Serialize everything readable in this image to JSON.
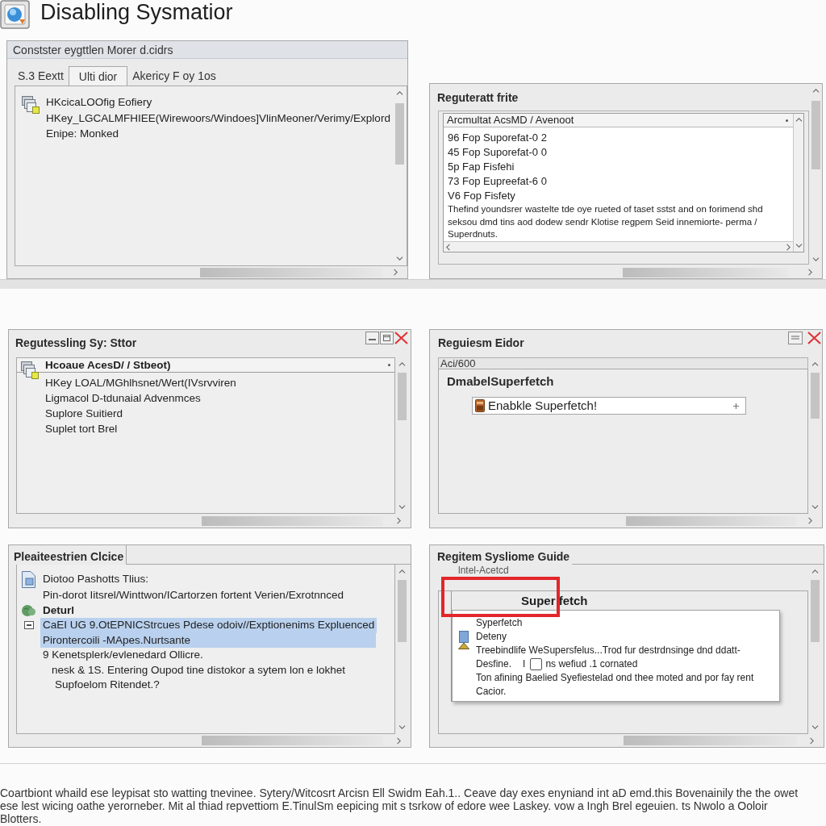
{
  "header": {
    "title": "Disabling Sysmatior"
  },
  "panels": [
    {
      "kind": "tabbed",
      "title": "Constster eygttlen Morer d.cidrs",
      "tabs": [
        {
          "label": "S.3 Eextt",
          "selected": false
        },
        {
          "label": "Ulti dior",
          "selected": true
        },
        {
          "label": "Akericy F oy 1os",
          "selected": false
        }
      ],
      "lines": [
        "HKcicaLOOfig Eofiery",
        "HKey_LGCALMFHIEE(Wirewoors/Windoes]VlinMeoner/Verimy/Explord",
        "Enipe: Monked"
      ]
    },
    {
      "kind": "list",
      "title": "Reguteratt frite",
      "list_header": "Arcmultat AcsMD / Avenoot",
      "rows": [
        "96 Fop Suporefat-0 2",
        "45 Fop Suporefat-0 0",
        "5p Fap Fisfehi",
        "73 Fop Eupreefat-6 0",
        "V6 Fop Fisfety"
      ],
      "note": "Thefind youndsrer wastelte tde oye rueted of taset sstst and on forimend shd seksou dmd tins aod dodew sendr Klotise regpem Seid innemiorte- perma / Superdnuts."
    },
    {
      "kind": "tree_window",
      "title": "Regutessling Sy: Sttor",
      "header": "Hcoaue AcesD/ / Stbeot)",
      "lines": [
        "HKey LOAL/MGhlhsnet/Wert(IVsrvviren",
        "Ligmacol D-tdunaial Advenmces",
        "Suplore Suitierd",
        "Suplet tort Brel"
      ]
    },
    {
      "kind": "editor",
      "title": "Reguiesm Eidor",
      "label": "Aci/600",
      "heading": "DmabelSuperfetch",
      "field": {
        "value": "Enabkle Superfetch!"
      }
    },
    {
      "kind": "outline",
      "title": "Pleaiteestrien Clcice",
      "items": [
        {
          "kind": "document",
          "text": "Diotoo Pashotts Tlius:",
          "selected": false
        },
        {
          "kind": "plain",
          "text": "Pin-dorot Iitsrel/Winttwon/ICartorzen fortent Verien/Exrotnnced",
          "selected": false
        },
        {
          "kind": "heading",
          "text": "Deturl",
          "selected": false
        },
        {
          "kind": "group",
          "text": "CaEI UG 9.OtEPNICStrcues Pdese odoiv//Exptionenims Expluenced",
          "selected": true,
          "expanded": true
        },
        {
          "kind": "plain",
          "text": "Pirontercoili -MApes.Nurtsante",
          "selected": true
        },
        {
          "kind": "plain",
          "text": "9 Kenetsplerk/evlenedard Ollicre.",
          "selected": false,
          "children": [
            {
              "text": "nesk & 1S. Entering Oupod tine distokor a sytem lon e lokhet",
              "selected": false,
              "children": [
                {
                  "text": "Supfoelom Ritendet.?",
                  "selected": false
                }
              ]
            }
          ]
        }
      ]
    },
    {
      "kind": "guide",
      "title": "Regitem Sysliome Guide",
      "caption": "lntel-Acetcd",
      "heading": "Super fetch",
      "card": {
        "title": "Syperfetch",
        "label": "Deteny",
        "line": "Treebindlife WeSupersfelus...Trod fur destrdnsinge dnd ddatt-",
        "option": {
          "label": "Desfine.",
          "marker": "I",
          "checked": false,
          "text": "ns wefiud .1 cornated"
        },
        "paragraph": "Ton afining Baelied Syefiestelad ond thee moted and por fay rent Cacior."
      }
    }
  ],
  "footer": {
    "text": "Coartbiont whaild ese leypisat sto watting tnevinee. Sytery/Witcosrt Arcisn Ell Swidm Eah.1.. Ceave day exes enyniand int aD emd.this Bovenainily the the owet ese lest wicing oathe yerorneber. Mit al thiad repvettiom E.TinulSm eepicing mit s tsrkow of edore wee Laskey. vow a Ingh Brel egeuien. ts Nwolo a Ooloir Blotters."
  }
}
